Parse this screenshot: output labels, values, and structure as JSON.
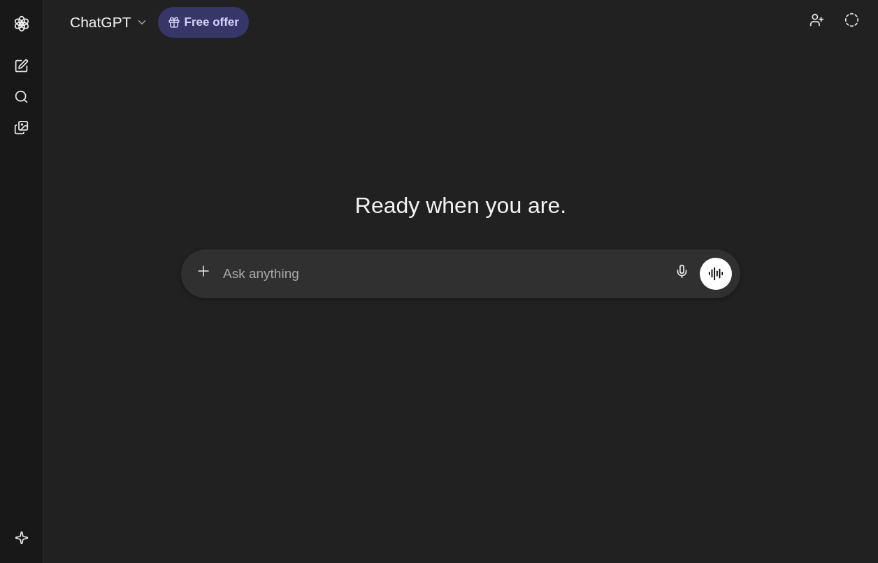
{
  "header": {
    "model": "ChatGPT",
    "offer": "Free offer"
  },
  "main": {
    "heading": "Ready when you are.",
    "composer": {
      "placeholder": "Ask anything"
    }
  }
}
